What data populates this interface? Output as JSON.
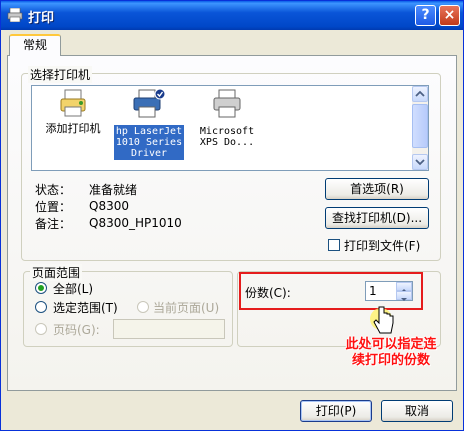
{
  "window": {
    "title": "打印",
    "help_label": "?",
    "close_label": "×"
  },
  "tab": {
    "label": "常规"
  },
  "select_printer": {
    "legend": "选择打印机",
    "printers": [
      {
        "name": "添加打印机",
        "icon": "add-printer-icon",
        "selected": false
      },
      {
        "name": "hp LaserJet 1010 Series Driver",
        "lines": [
          "hp LaserJet",
          "1010 Series",
          "Driver"
        ],
        "icon": "printer-default-icon",
        "selected": true
      },
      {
        "name": "Microsoft XPS Do...",
        "lines": [
          "Microsoft",
          "XPS Do..."
        ],
        "icon": "printer-icon",
        "selected": false
      }
    ]
  },
  "status": {
    "state_label": "状态：",
    "state_value": "准备就绪",
    "location_label": "位置：",
    "location_value": "Q8300",
    "comment_label": "备注：",
    "comment_value": "Q8300_HP1010"
  },
  "buttons": {
    "preferences": "首选项(R)",
    "find_printer": "查找打印机(D)...",
    "print_to_file": "打印到文件(F)",
    "print": "打印(P)",
    "cancel": "取消"
  },
  "page_range": {
    "legend": "页面范围",
    "all": "全部(L)",
    "selection": "选定范围(T)",
    "current_page": "当前页面(U)",
    "pages": "页码(G):",
    "selected": "all"
  },
  "copies": {
    "label": "份数(C):",
    "value": "1"
  },
  "annotation": {
    "line1": "此处可以指定连",
    "line2": "续打印的份数"
  },
  "colors": {
    "title_bar": "#0a55d8",
    "accent_red": "#e51c1c",
    "selection": "#316ac5"
  }
}
